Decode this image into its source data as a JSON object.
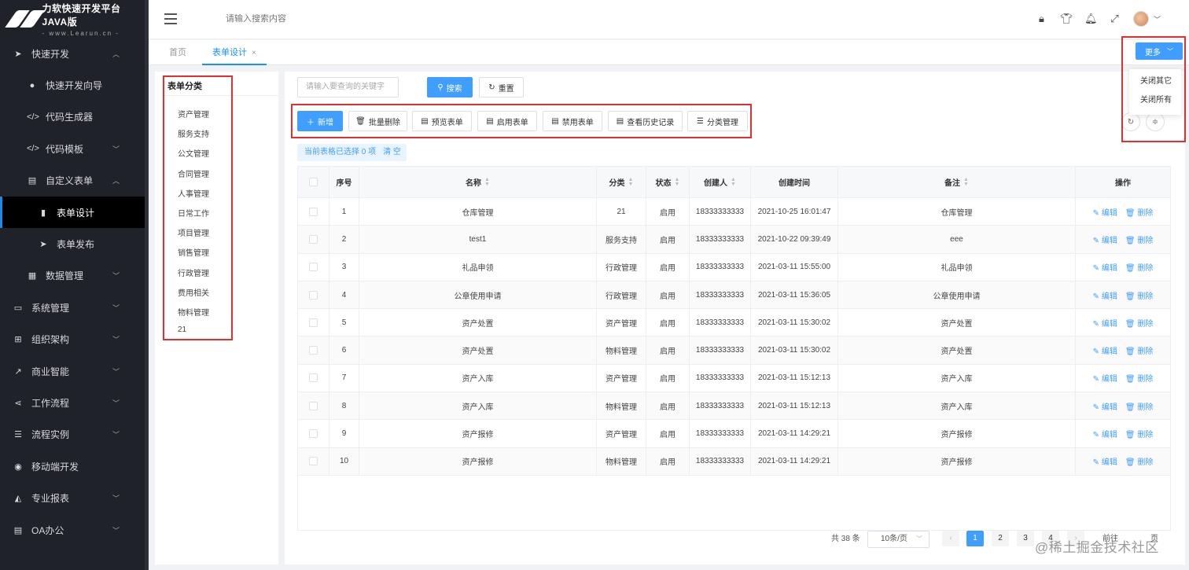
{
  "app": {
    "logo_title": "力软快速开发平台JAVA版",
    "logo_sub": "- www.Learun.cn -"
  },
  "sidebar": {
    "items": [
      {
        "label": "快速开发",
        "icon": "send-icon",
        "glyph": "➤",
        "level": 0,
        "chevron": "︿"
      },
      {
        "label": "快速开发向导",
        "icon": "compass-icon",
        "glyph": "●",
        "level": 1
      },
      {
        "label": "代码生成器",
        "icon": "code-icon",
        "glyph": "</>",
        "level": 1
      },
      {
        "label": "代码模板",
        "icon": "code-icon",
        "glyph": "</>",
        "level": 1,
        "chevron": "﹀"
      },
      {
        "label": "自定义表单",
        "icon": "file-icon",
        "glyph": "▤",
        "level": 1,
        "chevron": "︿"
      },
      {
        "label": "表单设计",
        "icon": "file-icon",
        "glyph": "▮",
        "level": 2,
        "active": true
      },
      {
        "label": "表单发布",
        "icon": "send-icon",
        "glyph": "➤",
        "level": 2
      },
      {
        "label": "数据管理",
        "icon": "database-icon",
        "glyph": "▦",
        "level": 1,
        "chevron": "﹀"
      },
      {
        "label": "系统管理",
        "icon": "monitor-icon",
        "glyph": "▭",
        "level": 0,
        "chevron": "﹀"
      },
      {
        "label": "组织架构",
        "icon": "sitemap-icon",
        "glyph": "⊞",
        "level": 0,
        "chevron": "﹀"
      },
      {
        "label": "商业智能",
        "icon": "line-chart-icon",
        "glyph": "↗",
        "level": 0,
        "chevron": "﹀"
      },
      {
        "label": "工作流程",
        "icon": "share-icon",
        "glyph": "⋖",
        "level": 0,
        "chevron": "﹀"
      },
      {
        "label": "流程实例",
        "icon": "list-icon",
        "glyph": "☰",
        "level": 0,
        "chevron": "﹀"
      },
      {
        "label": "移动端开发",
        "icon": "android-icon",
        "glyph": "◉",
        "level": 0
      },
      {
        "label": "专业报表",
        "icon": "area-chart-icon",
        "glyph": "◭",
        "level": 0,
        "chevron": "﹀"
      },
      {
        "label": "OA办公",
        "icon": "document-icon",
        "glyph": "▤",
        "level": 0,
        "chevron": "﹀"
      }
    ]
  },
  "header": {
    "search_placeholder": "请输入搜索内容"
  },
  "tabs": {
    "home": "首页",
    "active": "表单设计",
    "close": "×"
  },
  "more": {
    "button": "更多",
    "close_others": "关闭其它",
    "close_all": "关闭所有"
  },
  "categories": {
    "title": "表单分类",
    "items": [
      "资产管理",
      "服务支持",
      "公文管理",
      "合同管理",
      "人事管理",
      "日常工作",
      "项目管理",
      "销售管理",
      "行政管理",
      "费用相关",
      "物料管理",
      "21"
    ]
  },
  "query": {
    "keyword_placeholder": "请输入要查询的关键字",
    "search": "搜索",
    "reset": "重置"
  },
  "toolbar": {
    "add": "新增",
    "batch_delete": "批量删除",
    "preview": "预览表单",
    "enable": "启用表单",
    "disable": "禁用表单",
    "history": "查看历史记录",
    "category": "分类管理"
  },
  "selection": {
    "text": "当前表格已选择 0 项",
    "clear": "清 空"
  },
  "table": {
    "headers": [
      "序号",
      "名称",
      "分类",
      "状态",
      "创建人",
      "创建时间",
      "备注",
      "操作"
    ],
    "edit": "编辑",
    "delete": "删除",
    "rows": [
      {
        "no": "1",
        "name": "仓库管理",
        "category": "21",
        "status": "启用",
        "creator": "18333333333",
        "time": "2021-10-25 16:01:47",
        "remark": "仓库管理"
      },
      {
        "no": "2",
        "name": "test1",
        "category": "服务支持",
        "status": "启用",
        "creator": "18333333333",
        "time": "2021-10-22 09:39:49",
        "remark": "eee"
      },
      {
        "no": "3",
        "name": "礼品申领",
        "category": "行政管理",
        "status": "启用",
        "creator": "18333333333",
        "time": "2021-03-11 15:55:00",
        "remark": "礼品申领"
      },
      {
        "no": "4",
        "name": "公章使用申请",
        "category": "行政管理",
        "status": "启用",
        "creator": "18333333333",
        "time": "2021-03-11 15:36:05",
        "remark": "公章使用申请"
      },
      {
        "no": "5",
        "name": "资产处置",
        "category": "资产管理",
        "status": "启用",
        "creator": "18333333333",
        "time": "2021-03-11 15:30:02",
        "remark": "资产处置"
      },
      {
        "no": "6",
        "name": "资产处置",
        "category": "物料管理",
        "status": "启用",
        "creator": "18333333333",
        "time": "2021-03-11 15:30:02",
        "remark": "资产处置"
      },
      {
        "no": "7",
        "name": "资产入库",
        "category": "资产管理",
        "status": "启用",
        "creator": "18333333333",
        "time": "2021-03-11 15:12:13",
        "remark": "资产入库"
      },
      {
        "no": "8",
        "name": "资产入库",
        "category": "物料管理",
        "status": "启用",
        "creator": "18333333333",
        "time": "2021-03-11 15:12:13",
        "remark": "资产入库"
      },
      {
        "no": "9",
        "name": "资产报修",
        "category": "资产管理",
        "status": "启用",
        "creator": "18333333333",
        "time": "2021-03-11 14:29:21",
        "remark": "资产报修"
      },
      {
        "no": "10",
        "name": "资产报修",
        "category": "物料管理",
        "status": "启用",
        "creator": "18333333333",
        "time": "2021-03-11 14:29:21",
        "remark": "资产报修"
      }
    ]
  },
  "pagination": {
    "total": "共 38 条",
    "page_size": "10条/页",
    "pages": [
      "1",
      "2",
      "3",
      "4"
    ],
    "current": "1",
    "prev": "‹",
    "next": "›",
    "goto": "前往",
    "page_unit": "页"
  },
  "watermark": "@稀土掘金技术社区"
}
